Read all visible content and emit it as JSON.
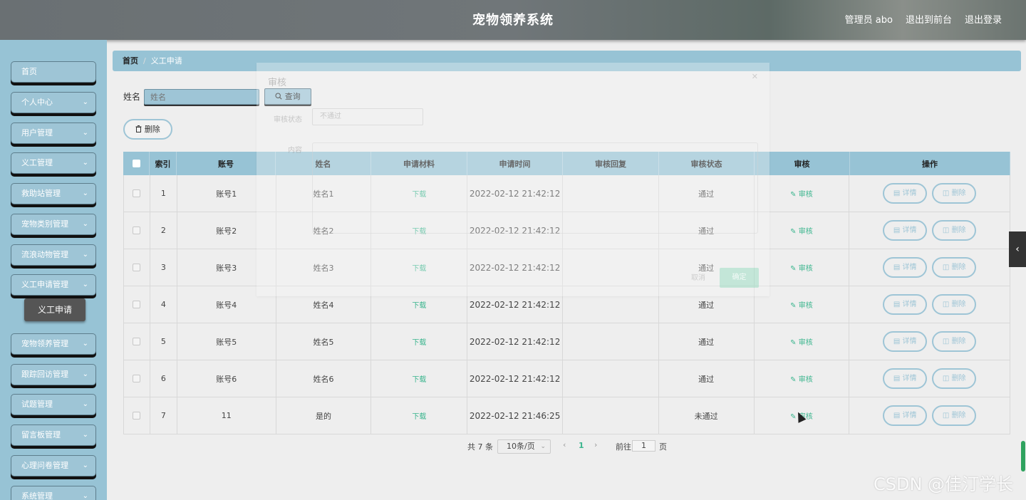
{
  "header": {
    "title": "宠物领养系统",
    "user": "管理员 abo",
    "front": "退出到前台",
    "logout": "退出登录"
  },
  "sidebar": {
    "items": [
      {
        "label": "首页",
        "has_sub": false
      },
      {
        "label": "个人中心",
        "has_sub": true
      },
      {
        "label": "用户管理",
        "has_sub": true
      },
      {
        "label": "义工管理",
        "has_sub": true
      },
      {
        "label": "救助站管理",
        "has_sub": true
      },
      {
        "label": "宠物类别管理",
        "has_sub": true
      },
      {
        "label": "流浪动物管理",
        "has_sub": true
      },
      {
        "label": "义工申请管理",
        "has_sub": true
      },
      {
        "label": "宠物领养管理",
        "has_sub": true
      },
      {
        "label": "跟踪回访管理",
        "has_sub": true
      },
      {
        "label": "试题管理",
        "has_sub": true
      },
      {
        "label": "留言板管理",
        "has_sub": true
      },
      {
        "label": "心理问卷管理",
        "has_sub": true
      },
      {
        "label": "系统管理",
        "has_sub": true
      }
    ],
    "sub_item": "义工申请",
    "chevron": "chevron-down-icon"
  },
  "breadcrumb": {
    "home": "首页",
    "separator": "/",
    "current": "义工申请"
  },
  "search": {
    "label": "姓名",
    "placeholder": "姓名",
    "button": "查询"
  },
  "toolbar": {
    "delete": "删除"
  },
  "table": {
    "headers": [
      "索引",
      "账号",
      "姓名",
      "申请材料",
      "申请时间",
      "审核回复",
      "审核状态",
      "审核",
      "操作"
    ],
    "rows": [
      {
        "index": "1",
        "account": "账号1",
        "name": "姓名1",
        "material": "下载",
        "time": "2022-02-12 21:42:12",
        "reply": "",
        "status": "通过",
        "audit": "审核"
      },
      {
        "index": "2",
        "account": "账号2",
        "name": "姓名2",
        "material": "下载",
        "time": "2022-02-12 21:42:12",
        "reply": "",
        "status": "通过",
        "audit": "审核"
      },
      {
        "index": "3",
        "account": "账号3",
        "name": "姓名3",
        "material": "下载",
        "time": "2022-02-12 21:42:12",
        "reply": "",
        "status": "通过",
        "audit": "审核"
      },
      {
        "index": "4",
        "account": "账号4",
        "name": "姓名4",
        "material": "下载",
        "time": "2022-02-12 21:42:12",
        "reply": "",
        "status": "通过",
        "audit": "审核"
      },
      {
        "index": "5",
        "account": "账号5",
        "name": "姓名5",
        "material": "下载",
        "time": "2022-02-12 21:42:12",
        "reply": "",
        "status": "通过",
        "audit": "审核"
      },
      {
        "index": "6",
        "account": "账号6",
        "name": "姓名6",
        "material": "下载",
        "time": "2022-02-12 21:42:12",
        "reply": "",
        "status": "通过",
        "audit": "审核"
      },
      {
        "index": "7",
        "account": "11",
        "name": "是的",
        "material": "下载",
        "time": "2022-02-12 21:46:25",
        "reply": "",
        "status": "未通过",
        "audit": "审核"
      }
    ],
    "row_actions": {
      "detail": "详情",
      "delete": "删除"
    }
  },
  "pagination": {
    "total": "共 7 条",
    "page_size": "10条/页",
    "current": "1",
    "goto": "前往",
    "goto_value": "1",
    "page_suffix": "页"
  },
  "dialog": {
    "title": "审核",
    "status_label": "审核状态",
    "status_value": "不通过",
    "content_label": "内容",
    "cancel": "取消",
    "confirm": "确定"
  },
  "watermark": "CSDN @佳汀学长",
  "colors": {
    "sidebar": "#97c3d5",
    "accent_green": "#3bb58e",
    "header": "#6a7073"
  }
}
